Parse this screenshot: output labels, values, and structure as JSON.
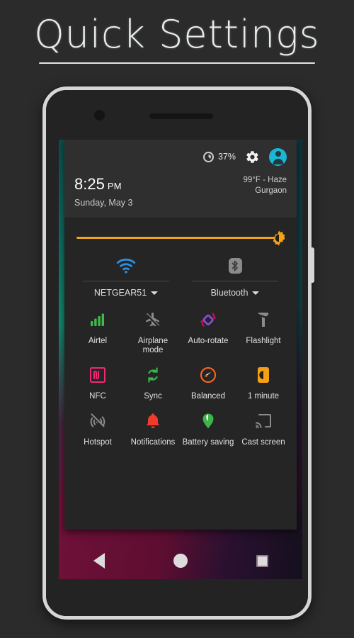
{
  "page": {
    "title": "Quick Settings"
  },
  "status": {
    "battery_percent": "37%",
    "battery_level": 37,
    "gear_icon": "gear-icon",
    "avatar_icon": "user-avatar-icon",
    "battery_icon": "battery-circle-icon"
  },
  "clock": {
    "time": "8:25",
    "ampm": "PM",
    "date": "Sunday, May 3"
  },
  "weather": {
    "temp_condition": "99°F - Haze",
    "location": "Gurgaon"
  },
  "brightness": {
    "label": "brightness-slider",
    "value_percent": 93,
    "icon": "brightness-sun-icon",
    "track_color": "#f0a31c"
  },
  "connectivity": [
    {
      "name": "wifi",
      "icon": "wifi-icon",
      "label": "NETGEAR51",
      "active": true,
      "color": "#2a8fe0",
      "caret": "chevron-down-icon"
    },
    {
      "name": "bluetooth",
      "icon": "bluetooth-icon",
      "label": "Bluetooth",
      "active": false,
      "color": "#8b8b8b",
      "caret": "chevron-down-icon"
    }
  ],
  "tiles": [
    [
      {
        "label": "Airtel",
        "icon": "signal-bars-icon",
        "color": "#3dbb4a",
        "active": true
      },
      {
        "label": "Airplane mode",
        "icon": "airplane-off-icon",
        "color": "#8b8b8b",
        "active": false
      },
      {
        "label": "Auto-rotate",
        "icon": "auto-rotate-icon",
        "color": "#8b4de0",
        "active": true
      },
      {
        "label": "Flashlight",
        "icon": "flashlight-off-icon",
        "color": "#8b8b8b",
        "active": false
      }
    ],
    [
      {
        "label": "NFC",
        "icon": "nfc-icon",
        "color": "#ef2a72",
        "active": true
      },
      {
        "label": "Sync",
        "icon": "sync-icon",
        "color": "#38b54a",
        "active": true
      },
      {
        "label": "Balanced",
        "icon": "performance-dial-icon",
        "color": "#f4631e",
        "active": true
      },
      {
        "label": "1 minute",
        "icon": "screen-timeout-icon",
        "color": "#f5a117",
        "active": true
      }
    ],
    [
      {
        "label": "Hotspot",
        "icon": "hotspot-off-icon",
        "color": "#8b8b8b",
        "active": false
      },
      {
        "label": "Notifications",
        "icon": "bell-icon",
        "color": "#f03a2e",
        "active": true
      },
      {
        "label": "Battery saving",
        "icon": "battery-saver-leaf-icon",
        "color": "#3db54a",
        "active": true
      },
      {
        "label": "Cast screen",
        "icon": "cast-screen-icon",
        "color": "#8b8b8b",
        "active": false
      }
    ]
  ],
  "navbar": [
    {
      "name": "back",
      "icon": "back-triangle-icon"
    },
    {
      "name": "home",
      "icon": "home-circle-icon"
    },
    {
      "name": "recents",
      "icon": "recents-square-icon"
    }
  ],
  "device": {
    "camera_icon": "front-camera-icon",
    "speaker_icon": "earpiece-speaker-icon",
    "power_button": "power-button"
  }
}
